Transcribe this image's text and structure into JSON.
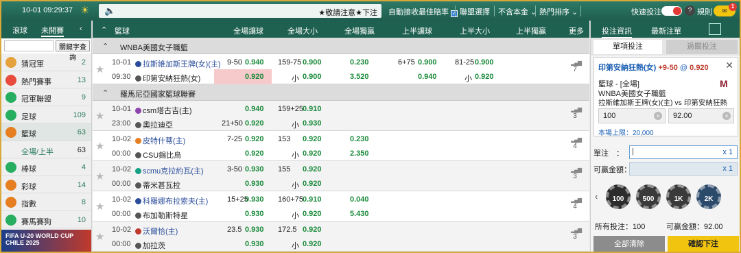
{
  "top": {
    "datetime": "10-01  09:29:37",
    "notice": "★敬請注意★下注",
    "auto_best": "自動接收最佳賠率",
    "league_select": "聯盟選擇",
    "currency": "不含本金 ⌄",
    "sort": "熱門排序 ⌄",
    "quick_bet": "快速投注",
    "rules": "規則",
    "badge": "1",
    "help": "?"
  },
  "left": {
    "tab_live": "滾球",
    "tab_upcoming": "未開賽",
    "search_btn": "關鍵字查詢",
    "items": [
      {
        "icon": "trophy-icon",
        "name": "猜冠軍",
        "count": "2",
        "color": "#e6a23c"
      },
      {
        "icon": "fire-icon",
        "name": "熱門賽事",
        "count": "13",
        "color": "#e74c3c"
      },
      {
        "icon": "cup-icon",
        "name": "冠軍聯盟",
        "count": "9",
        "color": "#27ae60"
      },
      {
        "icon": "soccer-icon",
        "name": "足球",
        "count": "109",
        "color": "#27ae60"
      },
      {
        "icon": "basketball-icon",
        "name": "籃球",
        "count": "63",
        "color": "#e67e22"
      },
      {
        "icon": "",
        "name": "全場/上半",
        "count": "63",
        "color": ""
      },
      {
        "icon": "baseball-icon",
        "name": "棒球",
        "count": "4",
        "color": "#27ae60"
      },
      {
        "icon": "lottery-icon",
        "name": "彩球",
        "count": "14",
        "color": "#e67e22"
      },
      {
        "icon": "index-icon",
        "name": "指數",
        "count": "8",
        "color": "#e67e22"
      },
      {
        "icon": "horse-icon",
        "name": "賽馬賽狗",
        "count": "10",
        "color": "#27ae60"
      }
    ],
    "banner": "FIFA U-20 WORLD CUP CHILE 2025"
  },
  "header": {
    "sport": "籃球",
    "c1": "全場讓球",
    "c2": "全場大小",
    "c3": "全場獨贏",
    "c4": "上半讓球",
    "c5": "上半大小",
    "c6": "上半獨贏",
    "more": "更多"
  },
  "leagues": [
    {
      "name": "WNBA美國女子職籃",
      "games": [
        {
          "d": "10-01",
          "t": "09:30",
          "h": "拉斯維加斯王牌(女)(主)",
          "a": "印第安納狂熱(女)",
          "hc1": "9-50",
          "o1": "0.940",
          "hc2": "",
          "o2": "0.920",
          "ou1": "159-75",
          "oo1": "0.900",
          "ou2": "小",
          "oo2": "0.900",
          "ml1": "0.230",
          "ml2": "3.520",
          "fh1": "6+75",
          "fo1": "0.900",
          "fh2": "",
          "fo2": "0.940",
          "fu1": "81-25",
          "fuo1": "0.900",
          "fu2": "小",
          "fuo2": "0.920",
          "more": "7"
        }
      ]
    },
    {
      "name": "羅馬尼亞國家籃球聯賽",
      "games": [
        {
          "d": "10-01",
          "t": "23:00",
          "h": "csm塔古吉(主)",
          "a": "奧拉迪亞",
          "hc1": "",
          "o1": "0.940",
          "hc2": "21+50",
          "o2": "0.920",
          "ou1": "159+25",
          "oo1": "0.910",
          "ou2": "小",
          "oo2": "0.930",
          "ml1": "",
          "ml2": "",
          "fh1": "",
          "fo1": "",
          "fh2": "",
          "fo2": "",
          "fu1": "",
          "fuo1": "",
          "fu2": "",
          "fuo2": "",
          "more": "3"
        },
        {
          "d": "10-02",
          "t": "00:00",
          "h": "皮特什蒂(主)",
          "a": "CSU錫比烏",
          "hc1": "7-25",
          "o1": "0.920",
          "hc2": "",
          "o2": "0.920",
          "ou1": "153",
          "oo1": "0.920",
          "ou2": "小",
          "oo2": "0.920",
          "ml1": "0.230",
          "ml2": "2.350",
          "fh1": "",
          "fo1": "",
          "fh2": "",
          "fo2": "",
          "fu1": "",
          "fuo1": "",
          "fu2": "",
          "fuo2": "",
          "more": "4"
        },
        {
          "d": "10-02",
          "t": "00:00",
          "h": "scmu克拉約瓦(主)",
          "a": "蒂米甚瓦拉",
          "hc1": "3-50",
          "o1": "0.930",
          "hc2": "",
          "o2": "0.930",
          "ou1": "155",
          "oo1": "0.920",
          "ou2": "小",
          "oo2": "0.920",
          "ml1": "",
          "ml2": "",
          "fh1": "",
          "fo1": "",
          "fh2": "",
          "fo2": "",
          "fu1": "",
          "fuo1": "",
          "fu2": "",
          "fuo2": "",
          "more": "3"
        },
        {
          "d": "10-02",
          "t": "00:00",
          "h": "科羅娜布拉索夫(主)",
          "a": "布加勒斯特星",
          "hc1": "15+25",
          "o1": "0.930",
          "hc2": "",
          "o2": "0.930",
          "ou1": "160+75",
          "oo1": "0.910",
          "ou2": "小",
          "oo2": "0.920",
          "ml1": "0.040",
          "ml2": "5.430",
          "fh1": "",
          "fo1": "",
          "fh2": "",
          "fo2": "",
          "fu1": "",
          "fuo1": "",
          "fu2": "",
          "fuo2": "",
          "more": "4"
        },
        {
          "d": "10-02",
          "t": "00:00",
          "h": "沃爾恰(主)",
          "a": "加拉茨",
          "hc1": "23.5",
          "o1": "0.930",
          "hc2": "",
          "o2": "0.930",
          "ou1": "172.5",
          "oo1": "0.920",
          "ou2": "小",
          "oo2": "0.920",
          "ml1": "",
          "ml2": "",
          "fh1": "",
          "fo1": "",
          "fh2": "",
          "fo2": "",
          "fu1": "",
          "fuo1": "",
          "fu2": "",
          "fuo2": "",
          "more": "3"
        }
      ]
    }
  ],
  "right": {
    "tab_info": "投注資訊",
    "tab_latest": "最新注單",
    "single": "單項投注",
    "parlay": "過關投注",
    "sel_team": "印第安納狂熱(女)",
    "sel_line": "+9-50",
    "sel_at": "@",
    "sel_odds": "0.920",
    "market": "籃球 - [全場]",
    "league": "WNBA美國女子職籃",
    "match": "拉斯維加斯王牌(女)(主) vs 印第安納狂熱(女)",
    "min": "100",
    "max": "92.00",
    "limit_label": "本場上限：",
    "limit": "20,000",
    "stake_label": "單注　：",
    "stake_mult": "x 1",
    "win_label": "可贏金額：",
    "win_mult": "x 1",
    "chips": [
      "100",
      "500",
      "1K",
      "2K"
    ],
    "total_stake": "所有投注：100",
    "total_win": "可贏金額：92.00",
    "clear": "全部清除",
    "confirm": "確認下注"
  },
  "colors": {
    "odds": "#1a8a3a",
    "header": "#1f6150",
    "accent": "#f1c40f"
  }
}
